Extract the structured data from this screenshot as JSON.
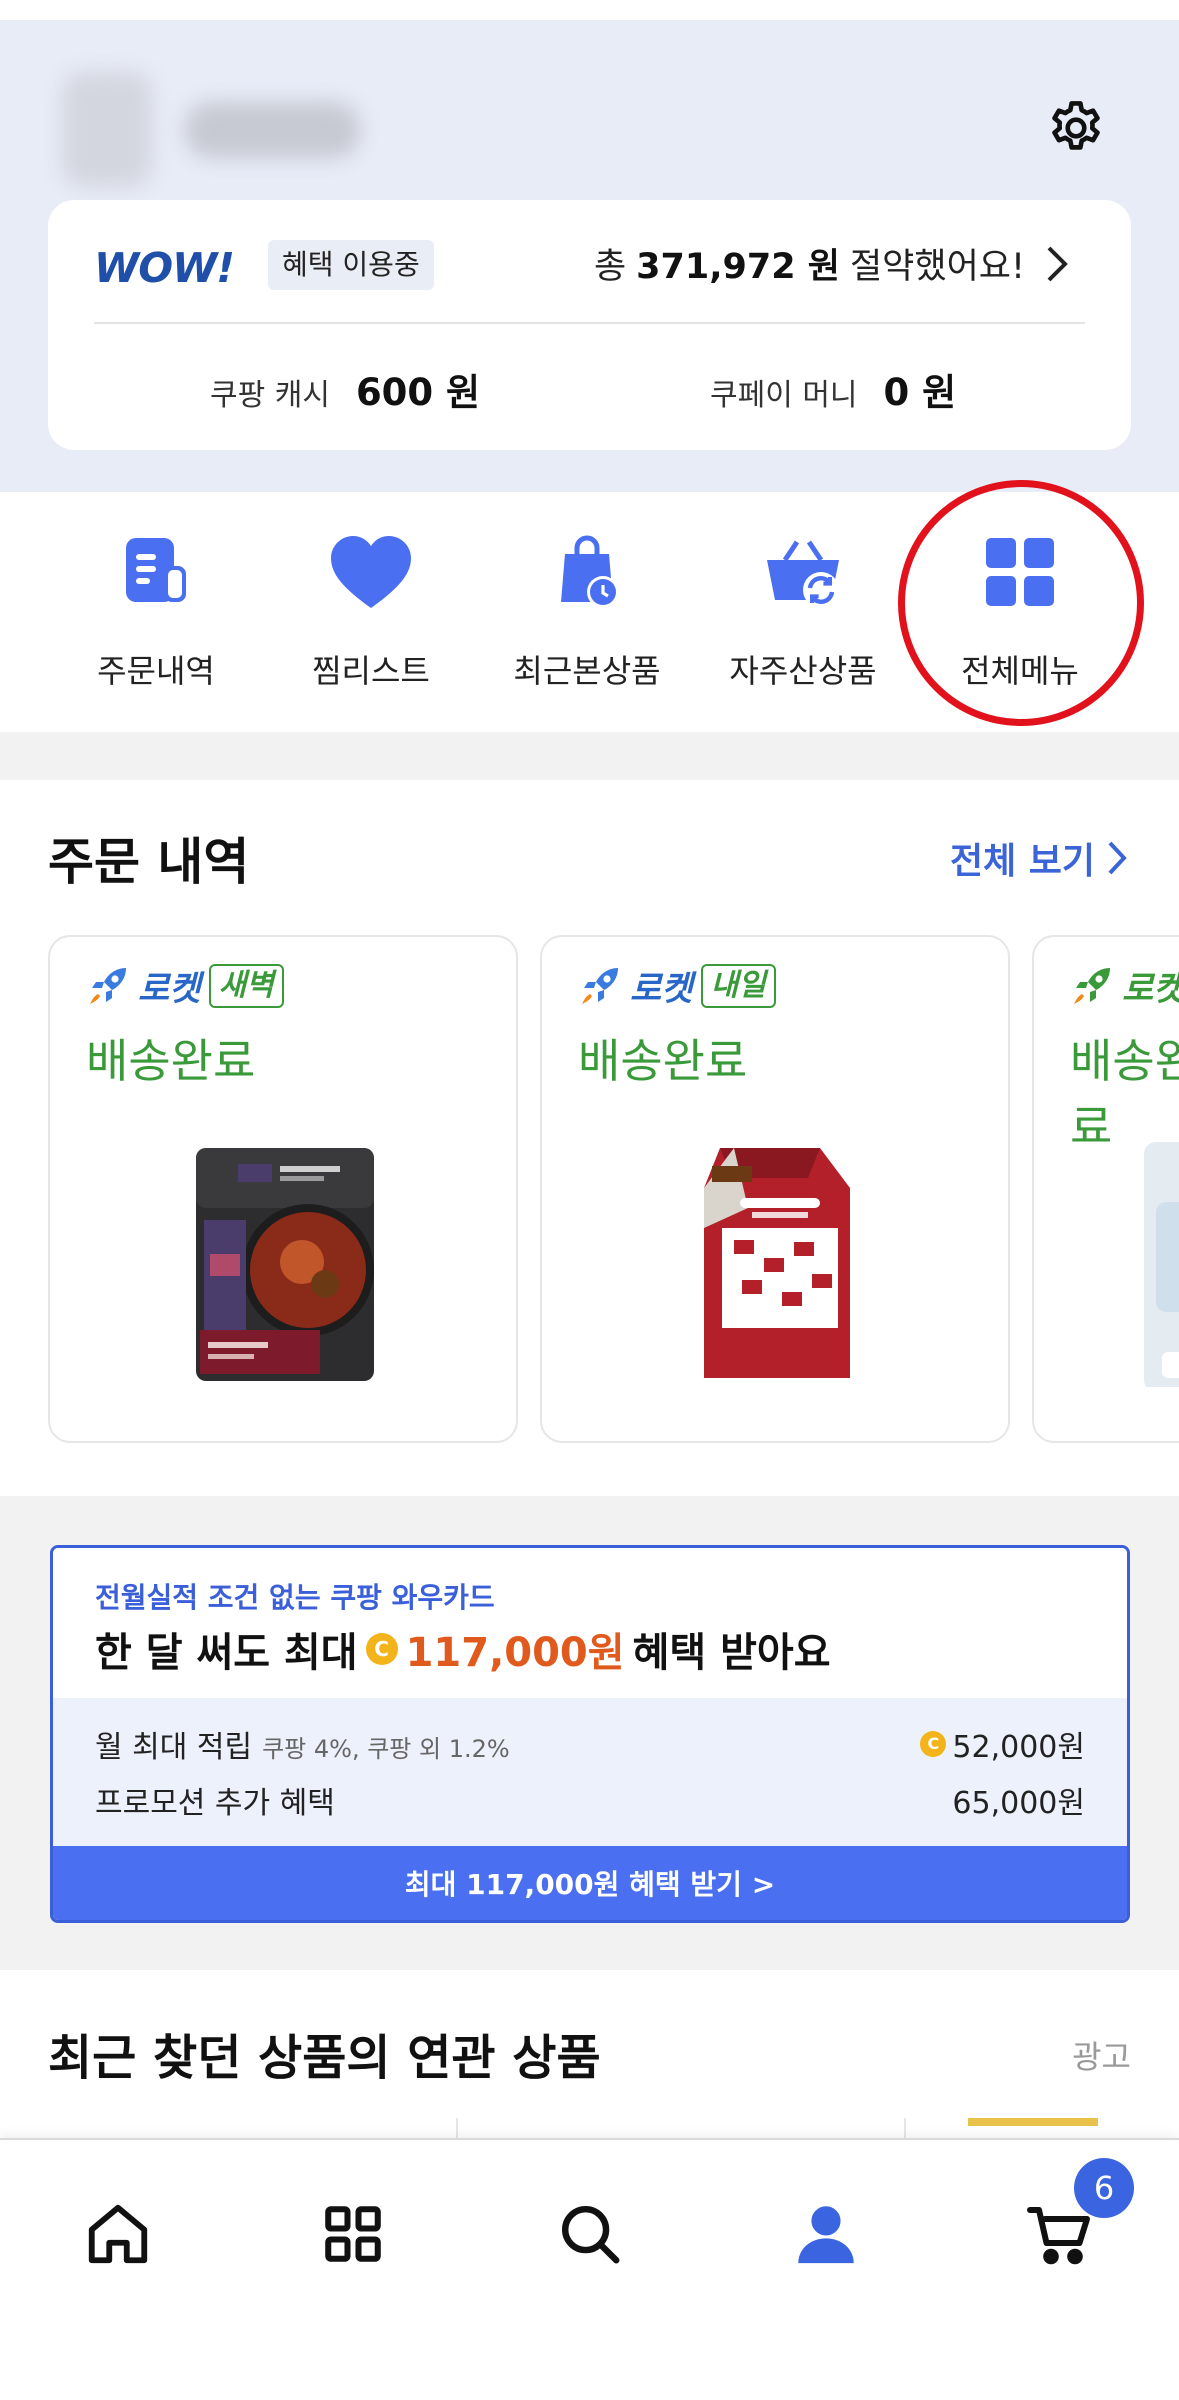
{
  "header": {
    "wow": {
      "logo": "WOW!",
      "badge": "혜택 이용중",
      "saved_prefix": "총",
      "saved_amount": "371,972 원",
      "saved_suffix": "절약했어요!"
    },
    "balances": [
      {
        "label": "쿠팡 캐시",
        "value": "600 원"
      },
      {
        "label": "쿠페이 머니",
        "value": "0 원"
      }
    ]
  },
  "quick_menu": [
    {
      "label": "주문내역",
      "icon": "order-history-icon"
    },
    {
      "label": "찜리스트",
      "icon": "heart-icon"
    },
    {
      "label": "최근본상품",
      "icon": "recent-bag-icon"
    },
    {
      "label": "자주산상품",
      "icon": "reorder-basket-icon"
    },
    {
      "label": "전체메뉴",
      "icon": "grid-menu-icon"
    }
  ],
  "orders": {
    "title": "주문 내역",
    "view_all": "전체 보기",
    "cards": [
      {
        "brand": "로켓",
        "tag": "새벽",
        "status": "배송완료"
      },
      {
        "brand": "로켓",
        "tag": "내일",
        "status": "배송완료"
      },
      {
        "brand": "로켓",
        "tag": "",
        "status": "배송완료"
      }
    ]
  },
  "promo": {
    "subtitle": "전월실적 조건 없는 쿠팡 와우카드",
    "headline_prefix": "한 달 써도 최대",
    "headline_amount": "117,000원",
    "headline_suffix": "혜택 받아요",
    "rows": [
      {
        "label": "월 최대 적립",
        "note": "쿠팡 4%, 쿠팡 외 1.2%",
        "value": "52,000원"
      },
      {
        "label": "프로모션 추가 혜택",
        "note": "",
        "value": "65,000원"
      }
    ],
    "button": "최대 117,000원 혜택 받기 >"
  },
  "related": {
    "title": "최근 찾던 상품의 연관 상품",
    "ad": "광고"
  },
  "bottom_nav": {
    "items": [
      "home-icon",
      "category-grid-icon",
      "search-icon",
      "my-account-icon",
      "cart-icon"
    ],
    "cart_count": "6"
  },
  "colors": {
    "accent": "#3a64d8",
    "header_bg": "#e8ecf7",
    "delivered_green": "#3a9a3a",
    "highlight_circle": "#e2121d"
  }
}
